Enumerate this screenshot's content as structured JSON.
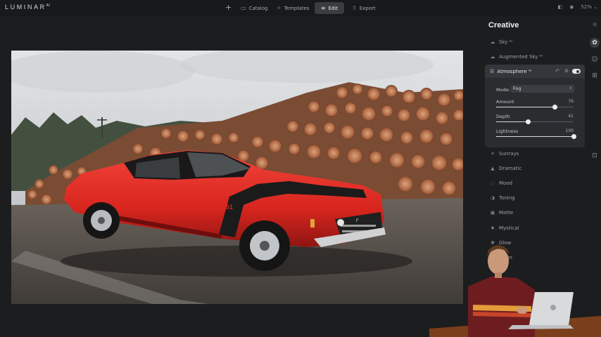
{
  "app": {
    "logo": "LUMINAR",
    "logo_sup": "AI"
  },
  "topbar": {
    "add_icon": "plus-icon",
    "catalog_label": "Catalog",
    "templates_label": "Templates",
    "edit_label": "Edit",
    "export_label": "Export",
    "zoom": "52%"
  },
  "panel": {
    "title": "Creative",
    "tools": [
      {
        "label": "Sky ᴬᴵ",
        "icon": "sky-icon"
      },
      {
        "label": "Augmented Sky ᴬᴵ",
        "icon": "augmented-sky-icon"
      },
      {
        "label": "Sunrays",
        "icon": "sunrays-icon"
      },
      {
        "label": "Dramatic",
        "icon": "dramatic-icon"
      },
      {
        "label": "Mood",
        "icon": "mood-icon"
      },
      {
        "label": "Toning",
        "icon": "toning-icon"
      },
      {
        "label": "Matte",
        "icon": "matte-icon"
      },
      {
        "label": "Mystical",
        "icon": "mystical-icon"
      },
      {
        "label": "Glow",
        "icon": "glow-icon"
      },
      {
        "label": "Grain",
        "icon": "grain-icon"
      }
    ],
    "atmosphere": {
      "title": "Atmosphere ᴬᴵ",
      "mode_label": "Mode:",
      "mode_value": "Fog",
      "sliders": [
        {
          "label": "Amount",
          "value": "76",
          "fraction": 0.76
        },
        {
          "label": "Depth",
          "value": "41",
          "fraction": 0.41
        },
        {
          "label": "Lightness",
          "value": "100",
          "fraction": 1.0
        }
      ]
    }
  },
  "photo": {
    "plate": "351",
    "badge": "F"
  }
}
